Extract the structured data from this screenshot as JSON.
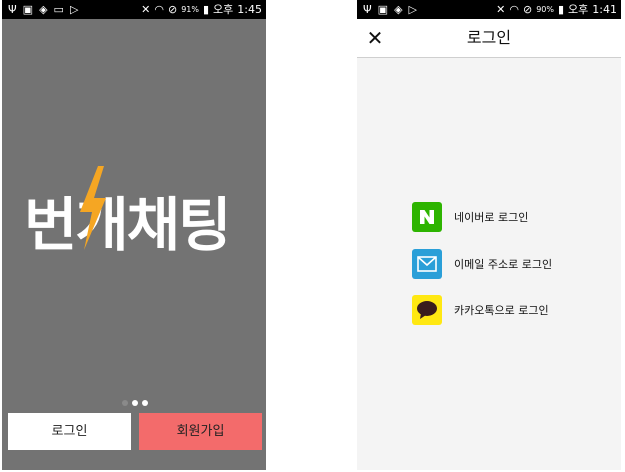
{
  "left_screen": {
    "status": {
      "battery": "91%",
      "ampm": "오후",
      "time": "1:45"
    },
    "logo_text": "번개채팅",
    "buttons": {
      "login_label": "로그인",
      "signup_label": "회원가입"
    },
    "pager": {
      "count": 3,
      "active_index": 2
    },
    "colors": {
      "background": "#737373",
      "signup": "#f36b6b",
      "bolt": "#f5a623"
    }
  },
  "right_screen": {
    "status": {
      "battery": "90%",
      "ampm": "오후",
      "time": "1:41"
    },
    "title": "로그인",
    "options": [
      {
        "label": "네이버로 로그인",
        "icon": "naver-icon",
        "color": "#2db400"
      },
      {
        "label": "이메일 주소로 로그인",
        "icon": "mail-icon",
        "color": "#2a9fd8"
      },
      {
        "label": "카카오톡으로 로그인",
        "icon": "kakao-icon",
        "color": "#ffe812"
      }
    ]
  }
}
